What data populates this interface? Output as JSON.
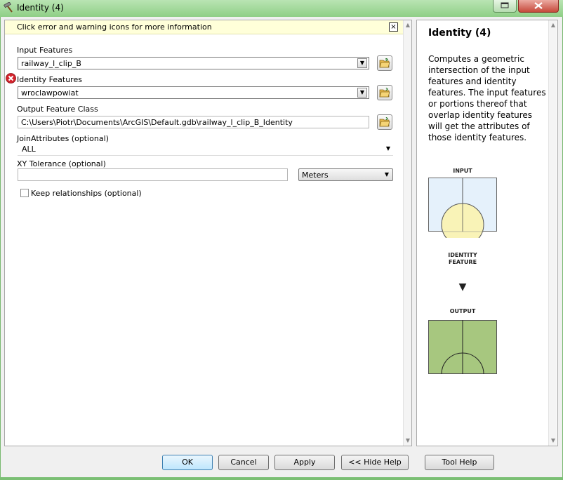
{
  "window": {
    "title": "Identity (4)"
  },
  "infobar": {
    "text": "Click error and warning icons for more information",
    "close_glyph": "×"
  },
  "params": {
    "input_features": {
      "label": "Input Features",
      "value": "railway_l_clip_B"
    },
    "identity_features": {
      "label": "Identity Features",
      "value": "wroclawpowiat"
    },
    "output_feature_class": {
      "label": "Output Feature Class",
      "value": "C:\\Users\\Piotr\\Documents\\ArcGIS\\Default.gdb\\railway_l_clip_B_Identity"
    },
    "join_attributes": {
      "label": "JoinAttributes (optional)",
      "value": "ALL"
    },
    "xy_tolerance": {
      "label": "XY Tolerance (optional)",
      "value": "",
      "units": "Meters"
    },
    "keep_relationships": {
      "label": "Keep relationships (optional)",
      "checked": false
    }
  },
  "help": {
    "title": "Identity (4)",
    "body": "Computes a geometric intersection of the input features and identity features. The input features or portions thereof that overlap identity features will get the attributes of those identity features.",
    "diagram": {
      "input_label": "INPUT",
      "identity_label_1": "IDENTITY",
      "identity_label_2": "FEATURE",
      "arrow_glyph": "▼",
      "output_label": "OUTPUT"
    }
  },
  "buttons": {
    "ok": "OK",
    "cancel": "Cancel",
    "apply": "Apply",
    "hide_help": "<< Hide Help",
    "tool_help": "Tool Help"
  },
  "colors": {
    "titlebar": "#9fd797",
    "infobar": "#ffffd9",
    "error": "#d3232c",
    "input_fill": "#e5f1fb",
    "identity_fill": "#f9f3b7",
    "output_fill": "#a7c77f"
  }
}
